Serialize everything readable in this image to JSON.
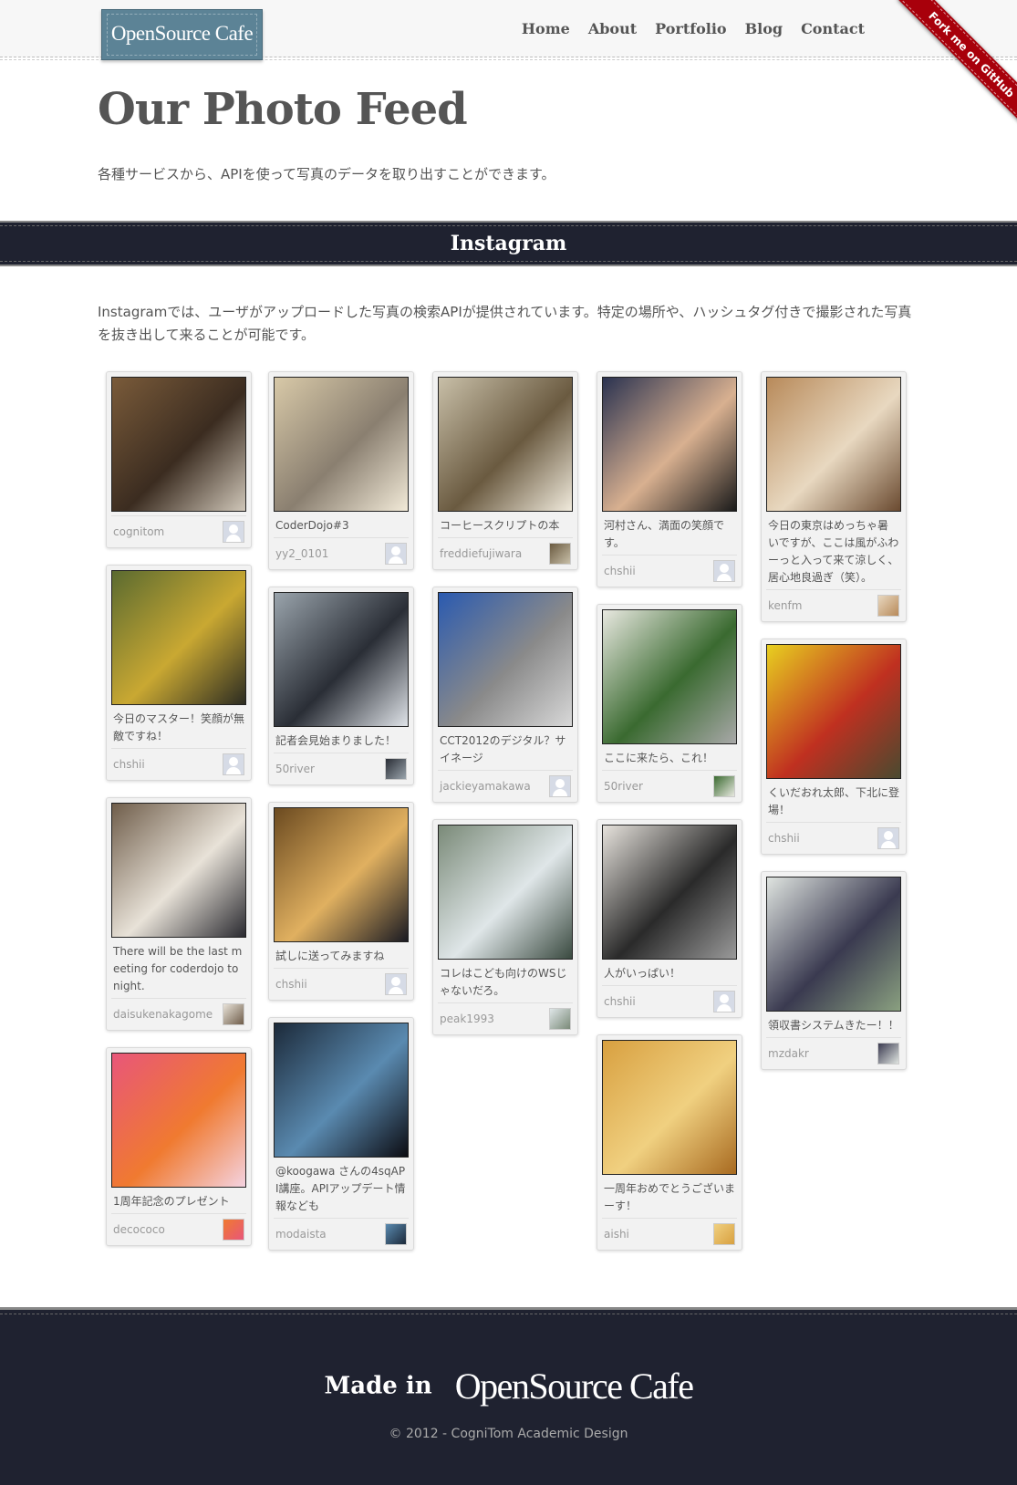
{
  "header": {
    "logo": "OpenSource Cafe",
    "nav": [
      "Home",
      "About",
      "Portfolio",
      "Blog",
      "Contact"
    ],
    "ribbon": "Fork me on GitHub"
  },
  "intro": {
    "title": "Our Photo Feed",
    "lead": "各種サービスから、APIを使って写真のデータを取り出すことができます。"
  },
  "section": {
    "title": "Instagram",
    "text": "Instagramでは、ユーザがアップロードした写真の検索APIが提供されています。特定の場所や、ハッシュタグ付きで撮影された写真を抜き出して来ることが可能です。"
  },
  "columns": [
    [
      {
        "caption": "",
        "user": "cognitom",
        "avatar": "default",
        "photo": [
          "#7a5b3a",
          "#3b2c20",
          "#cfc6b8"
        ]
      },
      {
        "caption": "今日のマスター！笑顔が無敵ですね！",
        "user": "chshii",
        "avatar": "default",
        "photo": [
          "#5a6a30",
          "#c9a832",
          "#2c2c22"
        ]
      },
      {
        "caption": "There will be the last meeting for coderdojo tonight.",
        "user": "daisukenakagome",
        "avatar": "photo",
        "photo": [
          "#6f5d4a",
          "#e8e2d8",
          "#2a2a30"
        ]
      },
      {
        "caption": "1周年記念のプレゼント",
        "user": "decococo",
        "avatar": "photo",
        "photo": [
          "#e8567a",
          "#f07a30",
          "#f4d2e0"
        ]
      }
    ],
    [
      {
        "caption": "CoderDojo#3",
        "user": "yy2_0101",
        "avatar": "default",
        "photo": [
          "#d8c9a8",
          "#8a7f70",
          "#f2ead8"
        ]
      },
      {
        "caption": "記者会見始まりました！",
        "user": "50river",
        "avatar": "photo",
        "photo": [
          "#9aa4ac",
          "#2a2e36",
          "#dfe3e8"
        ]
      },
      {
        "caption": "試しに送ってみますね",
        "user": "chshii",
        "avatar": "default",
        "photo": [
          "#6b4a20",
          "#e0b060",
          "#1a1a22"
        ]
      },
      {
        "caption": "@koogawa さんの4sqAPI講座。APIアップデート情報なども",
        "user": "modaista",
        "avatar": "photo",
        "photo": [
          "#1c2a3a",
          "#5a8ab0",
          "#0c0c12"
        ]
      }
    ],
    [
      {
        "caption": "コーヒースクリプトの本",
        "user": "freddiefujiwara",
        "avatar": "photo",
        "photo": [
          "#c8bfa8",
          "#6a5a40",
          "#f0eadc"
        ]
      },
      {
        "caption": "CCT2012のデジタル？サイネージ",
        "user": "jackieyamakawa",
        "avatar": "default",
        "photo": [
          "#2a5ab0",
          "#8a8a8a",
          "#d8d8d8"
        ]
      },
      {
        "caption": "コレはこども向けのWSじゃないだろ。",
        "user": "peak1993",
        "avatar": "photo",
        "photo": [
          "#7a8a78",
          "#dfe6e8",
          "#3a4a40"
        ]
      }
    ],
    [
      {
        "caption": "河村さん、満面の笑顔です。",
        "user": "chshii",
        "avatar": "default",
        "photo": [
          "#2a3250",
          "#d8b090",
          "#1a1a1a"
        ]
      },
      {
        "caption": "ここに来たら、これ！",
        "user": "50river",
        "avatar": "photo",
        "photo": [
          "#e8e8e0",
          "#3a6a30",
          "#a8a8a8"
        ]
      },
      {
        "caption": "人がいっぱい！",
        "user": "chshii",
        "avatar": "default",
        "photo": [
          "#e6e2dc",
          "#2a2a2a",
          "#9a9a9a"
        ]
      },
      {
        "caption": "一周年おめでとうございまーす！",
        "user": "aishi",
        "avatar": "photo",
        "photo": [
          "#d8a040",
          "#f0d080",
          "#a86a20"
        ]
      }
    ],
    [
      {
        "caption": "今日の東京はめっちゃ暑いですが、ここは風がふわーっと入って来て涼しく、居心地良過ぎ（笑）。",
        "user": "kenfm",
        "avatar": "photo",
        "photo": [
          "#b88a5a",
          "#e8d8c0",
          "#6a4a30"
        ]
      },
      {
        "caption": "くいだおれ太郎、下北に登場！",
        "user": "chshii",
        "avatar": "default",
        "photo": [
          "#e8d020",
          "#c03020",
          "#4a4a30"
        ]
      },
      {
        "caption": "領収書システムきたー！！",
        "user": "mzdakr",
        "avatar": "photo",
        "photo": [
          "#dfe4e0",
          "#3a3a50",
          "#8aa080"
        ]
      }
    ]
  ],
  "footer": {
    "made_in": "Made in",
    "brand": "OpenSource Cafe",
    "copyright": "© 2012 - CogniTom Academic Design"
  }
}
